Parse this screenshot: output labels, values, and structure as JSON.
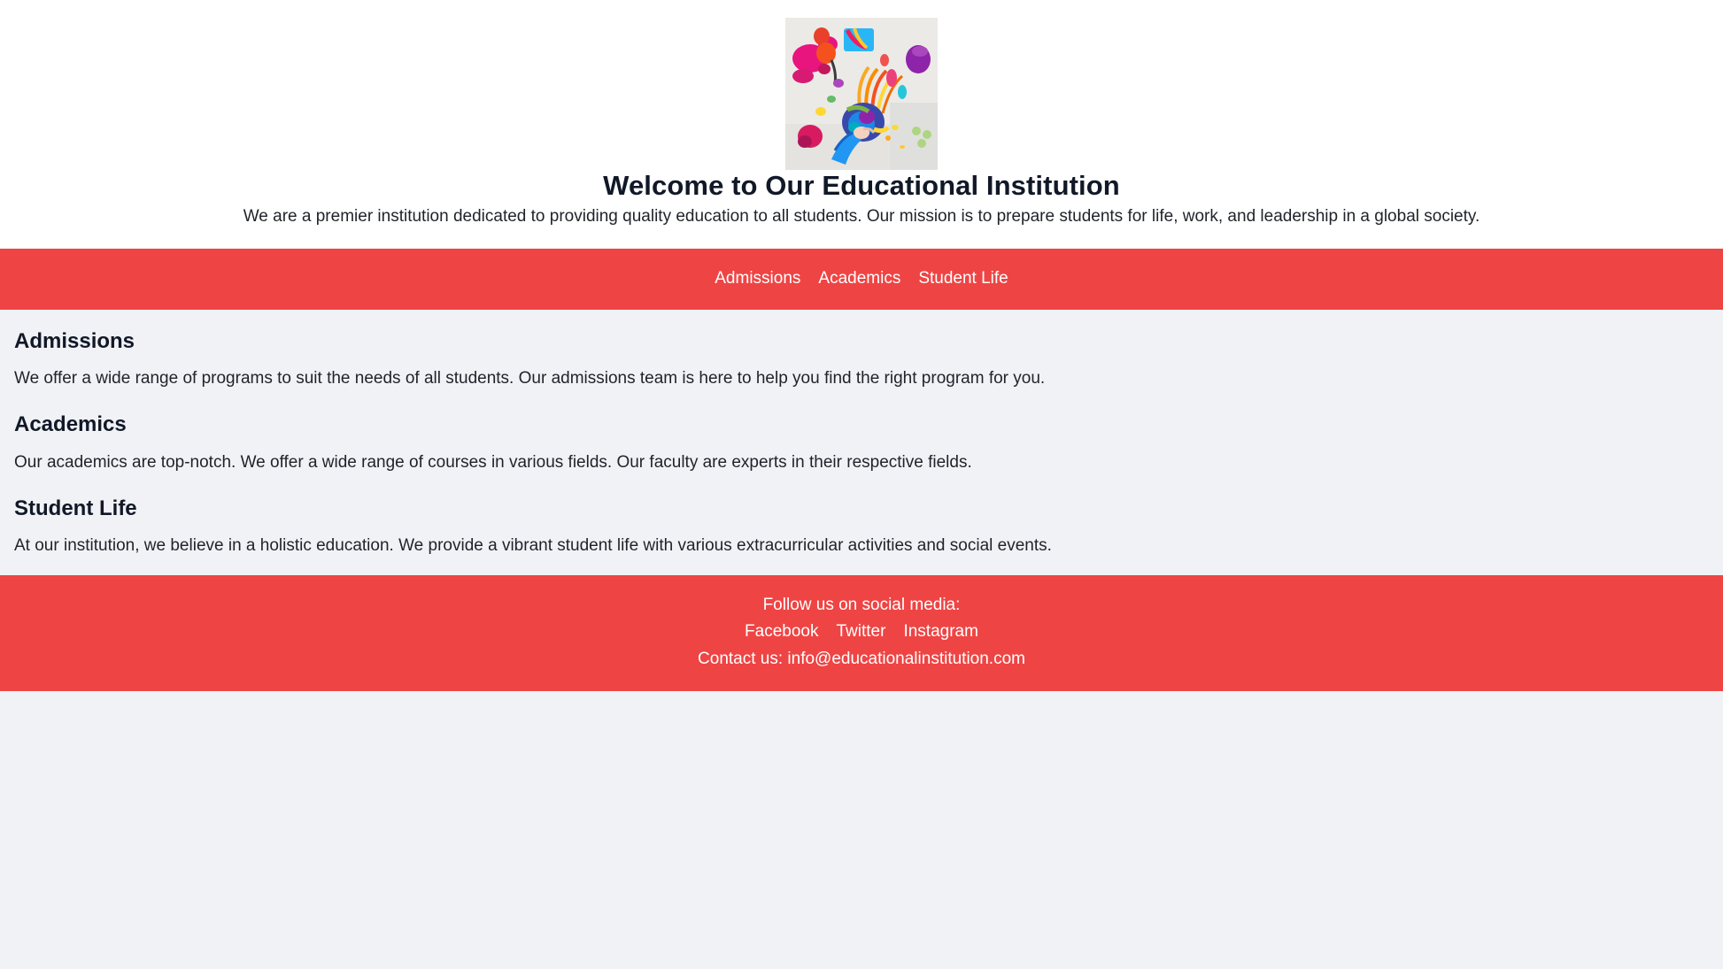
{
  "header": {
    "logo_alt": "Children's colorful finger paint artwork",
    "logo_icon": "paint-artwork-image",
    "title": "Welcome to Our Educational Institution",
    "tagline": "We are a premier institution dedicated to providing quality education to all students. Our mission is to prepare students for life, work, and leadership in a global society."
  },
  "nav": {
    "items": [
      {
        "label": "Admissions"
      },
      {
        "label": "Academics"
      },
      {
        "label": "Student Life"
      }
    ]
  },
  "main": {
    "sections": [
      {
        "title": "Admissions",
        "body": "We offer a wide range of programs to suit the needs of all students. Our admissions team is here to help you find the right program for you."
      },
      {
        "title": "Academics",
        "body": "Our academics are top-notch. We offer a wide range of courses in various fields. Our faculty are experts in their respective fields."
      },
      {
        "title": "Student Life",
        "body": "At our institution, we believe in a holistic education. We provide a vibrant student life with various extracurricular activities and social events."
      }
    ]
  },
  "footer": {
    "follow_heading": "Follow us on social media:",
    "social": [
      {
        "label": "Facebook"
      },
      {
        "label": "Twitter"
      },
      {
        "label": "Instagram"
      }
    ],
    "contact": "Contact us: info@educationalinstitution.com"
  },
  "colors": {
    "accent": "#ef4444",
    "page_background": "#f1f2f6",
    "header_background": "#ffffff",
    "text": "#111827",
    "inverse_text": "#ffffff"
  }
}
